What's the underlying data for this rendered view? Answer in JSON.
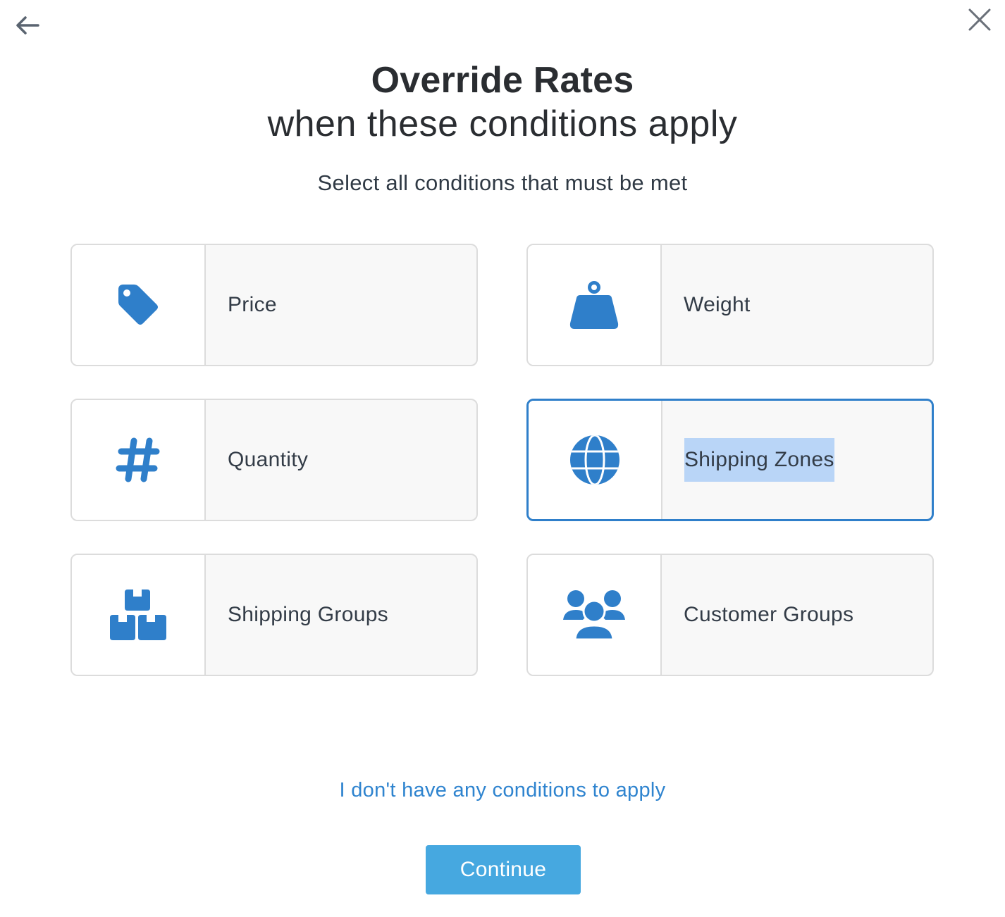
{
  "header": {
    "back_icon": "arrow-left-icon",
    "close_icon": "close-icon",
    "title": "Override Rates",
    "subtitle": "when these conditions apply",
    "instruction": "Select all conditions that must be met"
  },
  "colors": {
    "icon_blue": "#2f7fca",
    "selected_border": "#2f7fca",
    "link": "#2f84cf",
    "button": "#46a8e0",
    "text_highlight": "#b9d5f7"
  },
  "conditions": [
    {
      "label": "Price",
      "icon": "price-tag-icon",
      "selected": false
    },
    {
      "label": "Weight",
      "icon": "weight-icon",
      "selected": false
    },
    {
      "label": "Quantity",
      "icon": "hashtag-icon",
      "selected": false
    },
    {
      "label": "Shipping Zones",
      "icon": "globe-icon",
      "selected": true
    },
    {
      "label": "Shipping Groups",
      "icon": "boxes-icon",
      "selected": false
    },
    {
      "label": "Customer Groups",
      "icon": "users-icon",
      "selected": false
    }
  ],
  "footer": {
    "no_conditions_link": "I don't have any conditions to apply",
    "continue_label": "Continue"
  }
}
